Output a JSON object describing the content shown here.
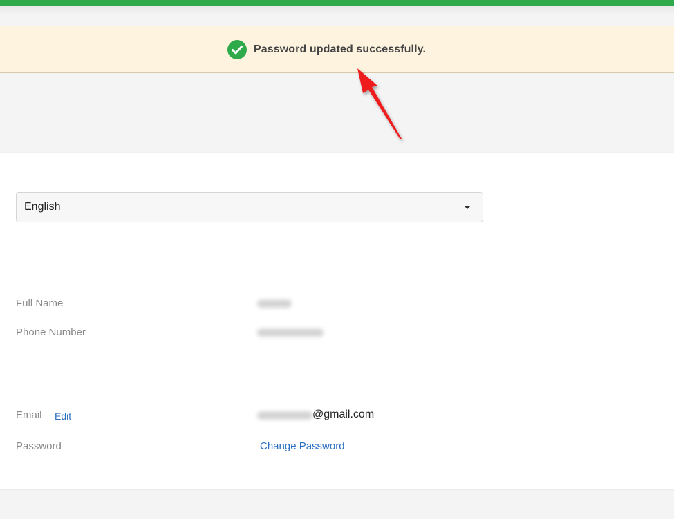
{
  "toast": {
    "message": "Password updated successfully.",
    "icon": "check-circle-icon",
    "icon_color": "#2eaa4a",
    "background": "#fdf3de"
  },
  "brand_color": "#2eaa4a",
  "language": {
    "selected": "English",
    "icon": "caret-down-icon"
  },
  "profile": {
    "full_name_label": "Full Name",
    "phone_label": "Phone Number"
  },
  "account": {
    "email_label": "Email",
    "email_edit_label": "Edit",
    "email_value": "@gmail.com",
    "password_label": "Password",
    "change_password_label": "Change Password"
  },
  "link_color": "#2b6fc2"
}
